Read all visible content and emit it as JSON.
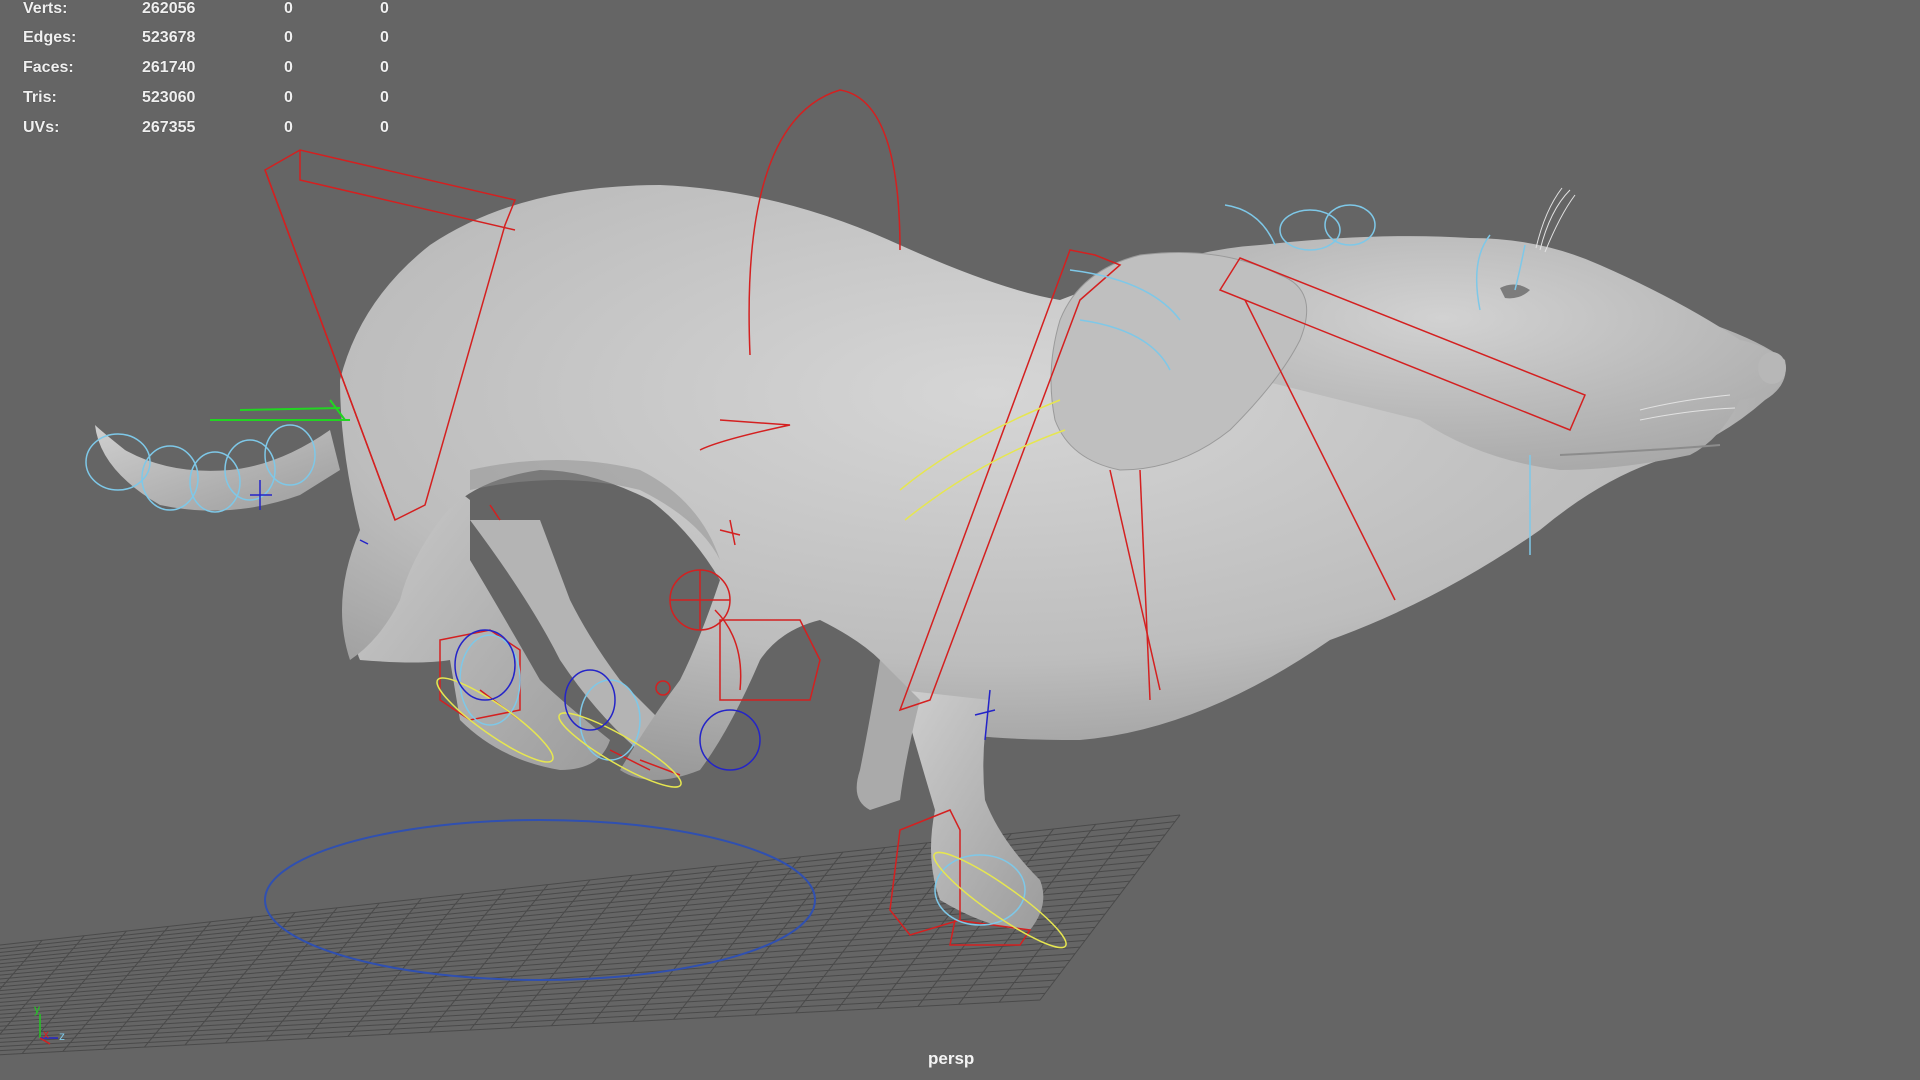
{
  "hud": {
    "rows": [
      {
        "label": "Verts:",
        "c1": "262056",
        "c2": "0",
        "c3": "0"
      },
      {
        "label": "Edges:",
        "c1": "523678",
        "c2": "0",
        "c3": "0"
      },
      {
        "label": "Faces:",
        "c1": "261740",
        "c2": "0",
        "c3": "0"
      },
      {
        "label": "Tris:",
        "c1": "523060",
        "c2": "0",
        "c3": "0"
      },
      {
        "label": "UVs:",
        "c1": "267355",
        "c2": "0",
        "c3": "0"
      }
    ]
  },
  "camera": {
    "name": "persp"
  },
  "axis": {
    "y": "y",
    "x": "x",
    "z": "z"
  },
  "colors": {
    "background": "#656565",
    "mesh": "#c9c9c9",
    "grid": "#4a4a4a",
    "rig_red": "#d42020",
    "rig_cyan": "#7ec8e8",
    "rig_yellow": "#e6e650",
    "rig_blue": "#2424c8",
    "rig_green": "#22d422"
  }
}
